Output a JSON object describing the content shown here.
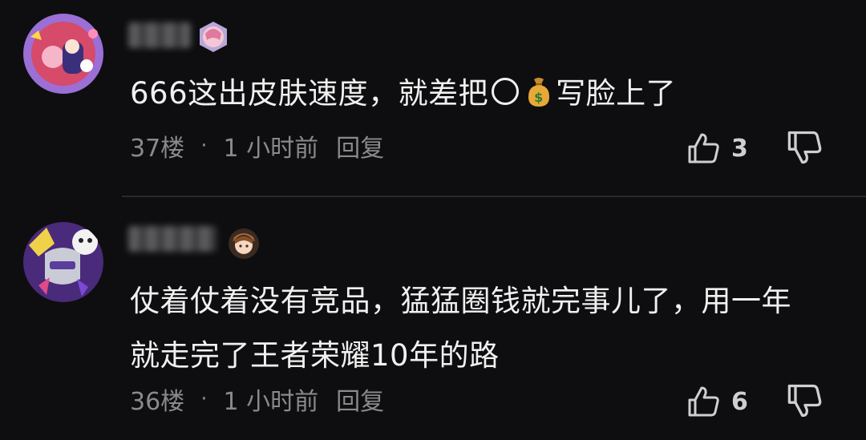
{
  "comments": [
    {
      "text_before": "666这出皮肤速度，就差把",
      "text_after": "写脸上了",
      "floor": "37楼",
      "separator": "·",
      "time": "1 小时前",
      "reply_label": "回复",
      "likes": "3"
    },
    {
      "text": "仗着仗着没有竞品，猛猛圈钱就完事儿了，用一年就走完了王者荣耀10年的路",
      "floor": "36楼",
      "separator": "·",
      "time": "1 小时前",
      "reply_label": "回复",
      "likes": "6"
    }
  ],
  "icons": {
    "like": "thumbs-up-icon",
    "dislike": "thumbs-down-icon",
    "money_bag": "money-bag-emoji"
  }
}
